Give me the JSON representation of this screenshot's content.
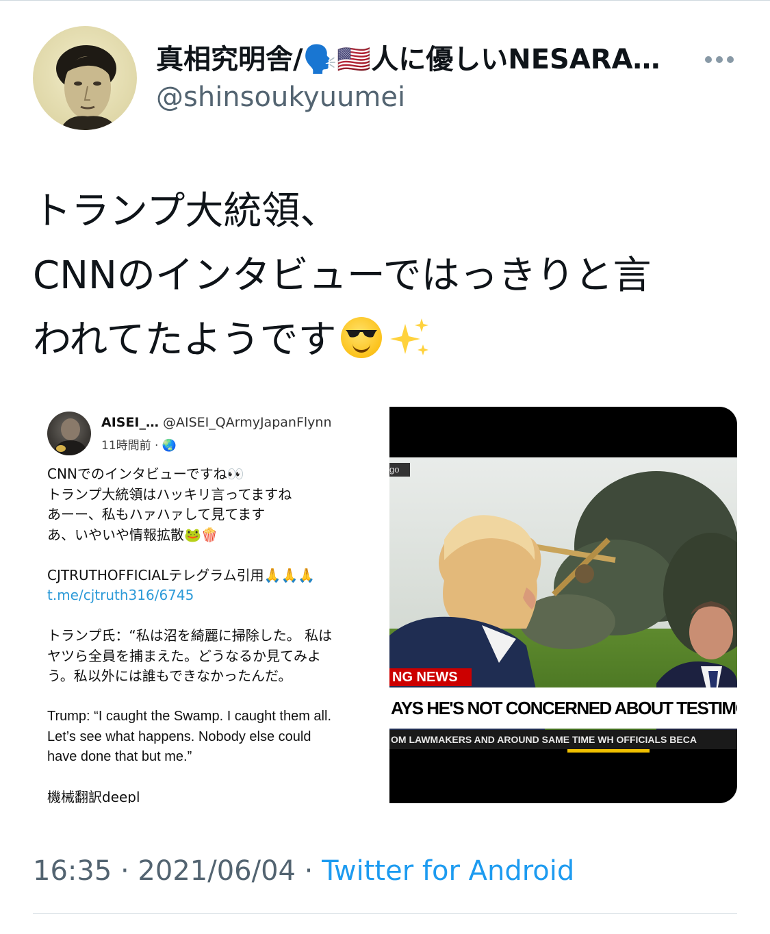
{
  "author": {
    "display_name": "真相究明舎/🗣️🇺🇸人に優しいNESARA…",
    "handle": "@shinsoukyuumei"
  },
  "tweet": {
    "lines": [
      "トランプ大統領、",
      "CNNのインタビューではっきりと言",
      "われてたようです"
    ],
    "timestamp": "16:35 · 2021/06/04 · ",
    "source": "Twitter for Android"
  },
  "media": {
    "quoted_post": {
      "name": "AISEI_…",
      "handle": "@AISEI_QArmyJapanFlynn",
      "time": "11時間前 · 🌏",
      "body": [
        "CNNでのインタビューですね👀",
        "トランプ大統領はハッキリ言ってますね",
        "あーー、私もハァハァして見てます",
        "あ、いやいや情報拡散🐸🍿",
        "",
        "CJTRUTHOFFICIALテレグラム引用🙏🙏🙏",
        "t.me/cjtruth316/6745",
        "",
        "トランプ氏：“私は沼を綺麗に掃除した。 私は",
        "ヤツら全員を捕まえた。どうなるか見てみよ",
        "う。私以外には誰もできなかったんだ。",
        "",
        "Trump: “I caught the Swamp. I caught them all.",
        "Let’s see what happens. Nobody else could",
        "have done that but me.”",
        "",
        "機械翻訳deepl"
      ]
    },
    "news_screenshot": {
      "corner_label": "go",
      "ticker_red": "NG NEWS",
      "ticker_main": "AYS HE'S NOT CONCERNED ABOUT TESTIMONY SO FAR",
      "ticker_sub": "OM LAWMAKERS AND AROUND SAME TIME WH OFFICIALS BECA"
    }
  },
  "colors": {
    "text": "#0f1419",
    "secondary": "#536471",
    "link": "#1d9bf0",
    "divider": "#cfd9de",
    "cnn_red": "#cc0000"
  },
  "icons": [
    "more-options-icon",
    "speaking-head-emoji",
    "us-flag-emoji",
    "smiling-face-with-sunglasses-emoji",
    "sparkles-emoji"
  ]
}
